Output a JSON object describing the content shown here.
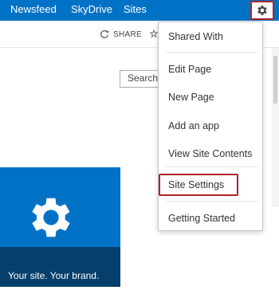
{
  "suite_bar": {
    "links": [
      "Newsfeed",
      "SkyDrive",
      "Sites"
    ],
    "accent_color": "#0072c6",
    "settings_icon": "gear-icon"
  },
  "ribbon": {
    "share_label": "SHARE",
    "share_icon": "share-icon",
    "follow_icon": "star-icon"
  },
  "search": {
    "placeholder": "Search"
  },
  "settings_menu": {
    "items": [
      "Shared With",
      "Edit Page",
      "New Page",
      "Add an app",
      "View Site Contents",
      "Site Settings",
      "Getting Started"
    ],
    "highlighted_item": "Site Settings",
    "highlight_color": "#b0222d"
  },
  "brand_tile": {
    "caption": "Your site. Your brand.",
    "icon": "gear-icon",
    "tile_color": "#0072c6"
  }
}
